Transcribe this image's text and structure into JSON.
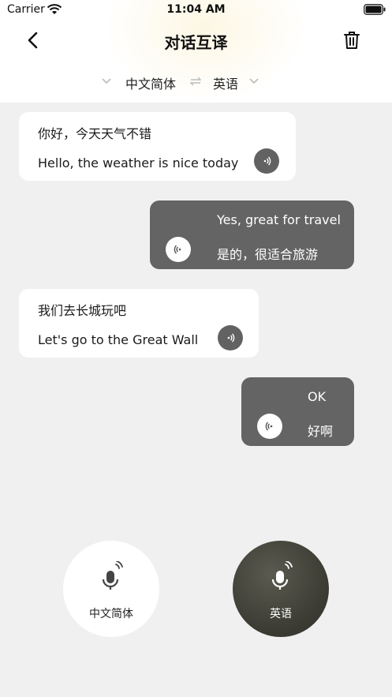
{
  "status_bar": {
    "carrier": "Carrier",
    "time": "11:04 AM"
  },
  "nav": {
    "title": "对话互译",
    "back_icon": "chevron-left-icon",
    "trash_icon": "trash-icon"
  },
  "language_bar": {
    "source": "中文简体",
    "target": "英语",
    "swap_icon": "swap-arrows-icon"
  },
  "messages": [
    {
      "side": "left",
      "line1": "你好，今天天气不错",
      "line2": "Hello, the weather is nice today"
    },
    {
      "side": "right",
      "line1": "Yes, great for travel",
      "line2": "是的，很适合旅游"
    },
    {
      "side": "left",
      "line1": "我们去长城玩吧",
      "line2": "Let's go to the Great Wall"
    },
    {
      "side": "right",
      "line1": "OK",
      "line2": "好啊"
    }
  ],
  "mic_buttons": {
    "left_label": "中文简体",
    "right_label": "英语"
  },
  "colors": {
    "background": "#f0f0f0",
    "bubble_left": "#ffffff",
    "bubble_right": "#646464",
    "mic_dark": "#3a3a32"
  }
}
